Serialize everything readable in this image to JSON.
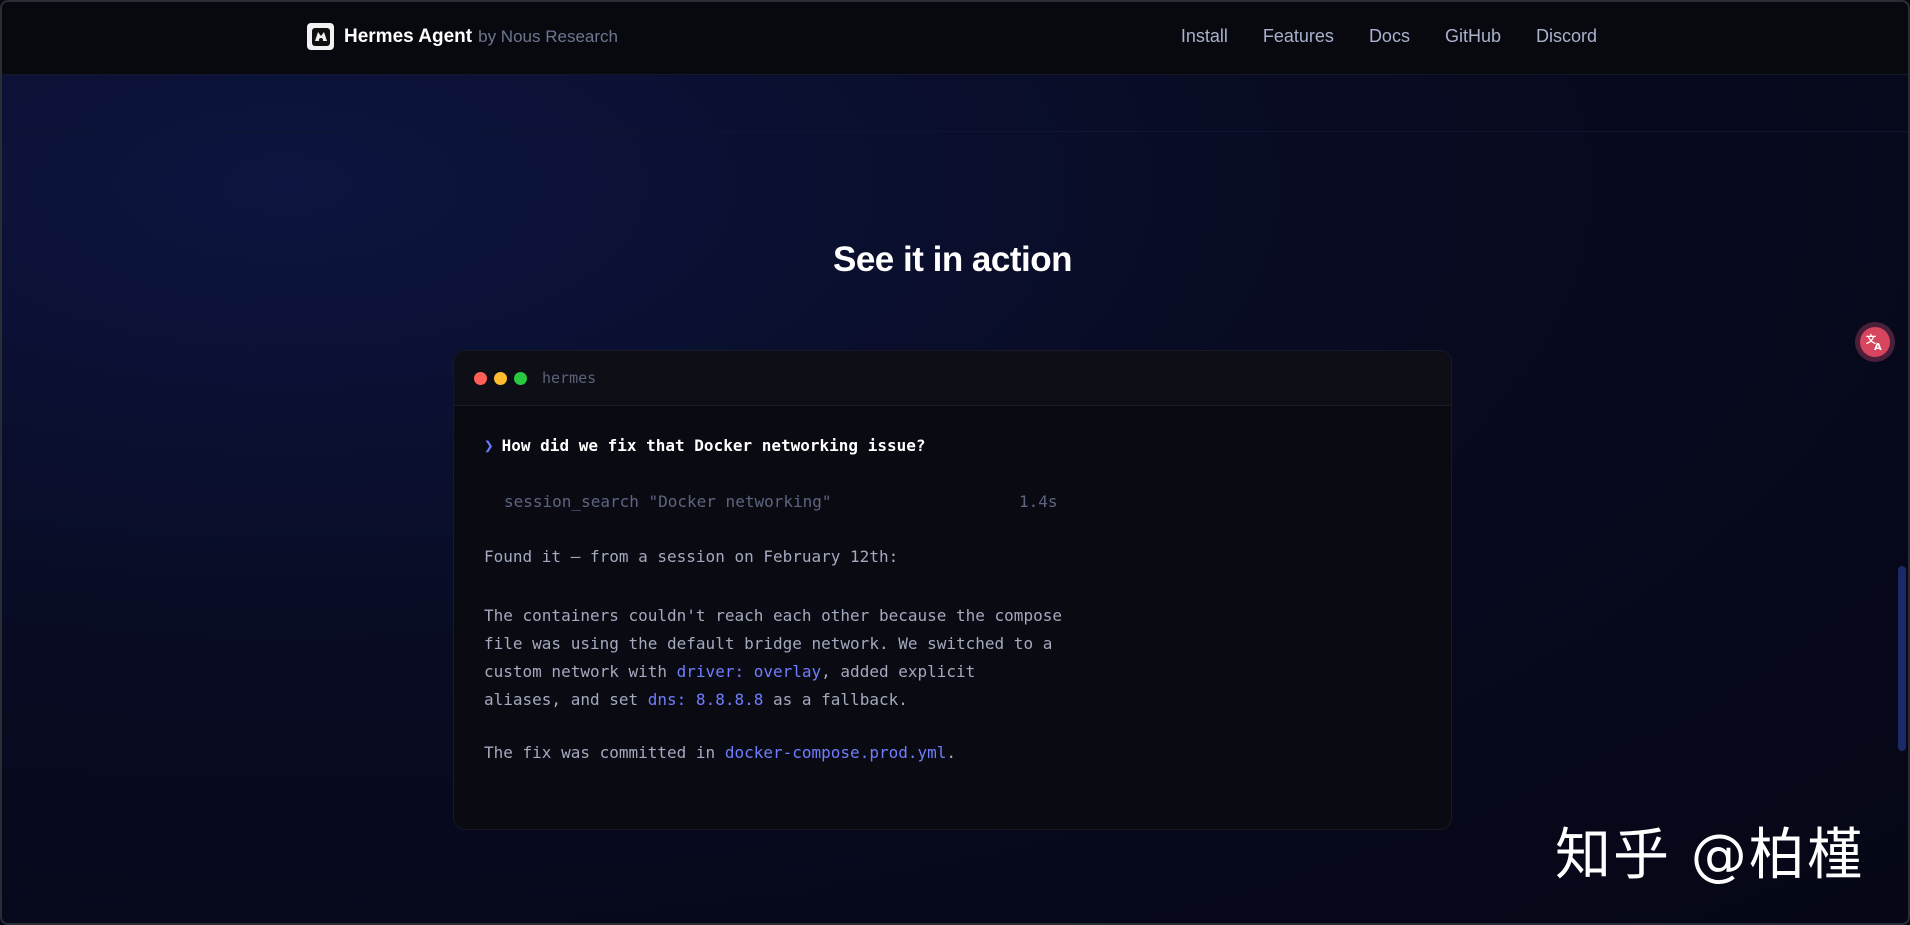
{
  "nav": {
    "brand_name": "Hermes Agent",
    "brand_by": "by Nous Research",
    "links": [
      "Install",
      "Features",
      "Docs",
      "GitHub",
      "Discord"
    ]
  },
  "section": {
    "title": "See it in action"
  },
  "terminal": {
    "title": "hermes",
    "prompt": "How did we fix that Docker networking issue?",
    "tool_call": "session_search \"Docker networking\"",
    "tool_time": "1.4s",
    "found": "Found it — from a session on February 12th:",
    "para_line1": "The containers couldn't reach each other because the compose",
    "para_line2": "file was using the default bridge network. We switched to a",
    "para_line3_pre": "custom network with ",
    "para_line3_code": "driver: overlay",
    "para_line3_post": ", added explicit",
    "para_line4_pre": "aliases, and set ",
    "para_line4_code": "dns: 8.8.8.8",
    "para_line4_post": " as a fallback.",
    "fix_pre": "The fix was committed in ",
    "fix_code": "docker-compose.prod.yml",
    "fix_post": "."
  },
  "widgets": {
    "translate_icon": "translate-icon",
    "watermark": "知乎 @柏槿"
  },
  "colors": {
    "accent": "#6f7dff",
    "dot_red": "#ff5f57",
    "dot_yellow": "#febc2e",
    "dot_green": "#28c840"
  }
}
